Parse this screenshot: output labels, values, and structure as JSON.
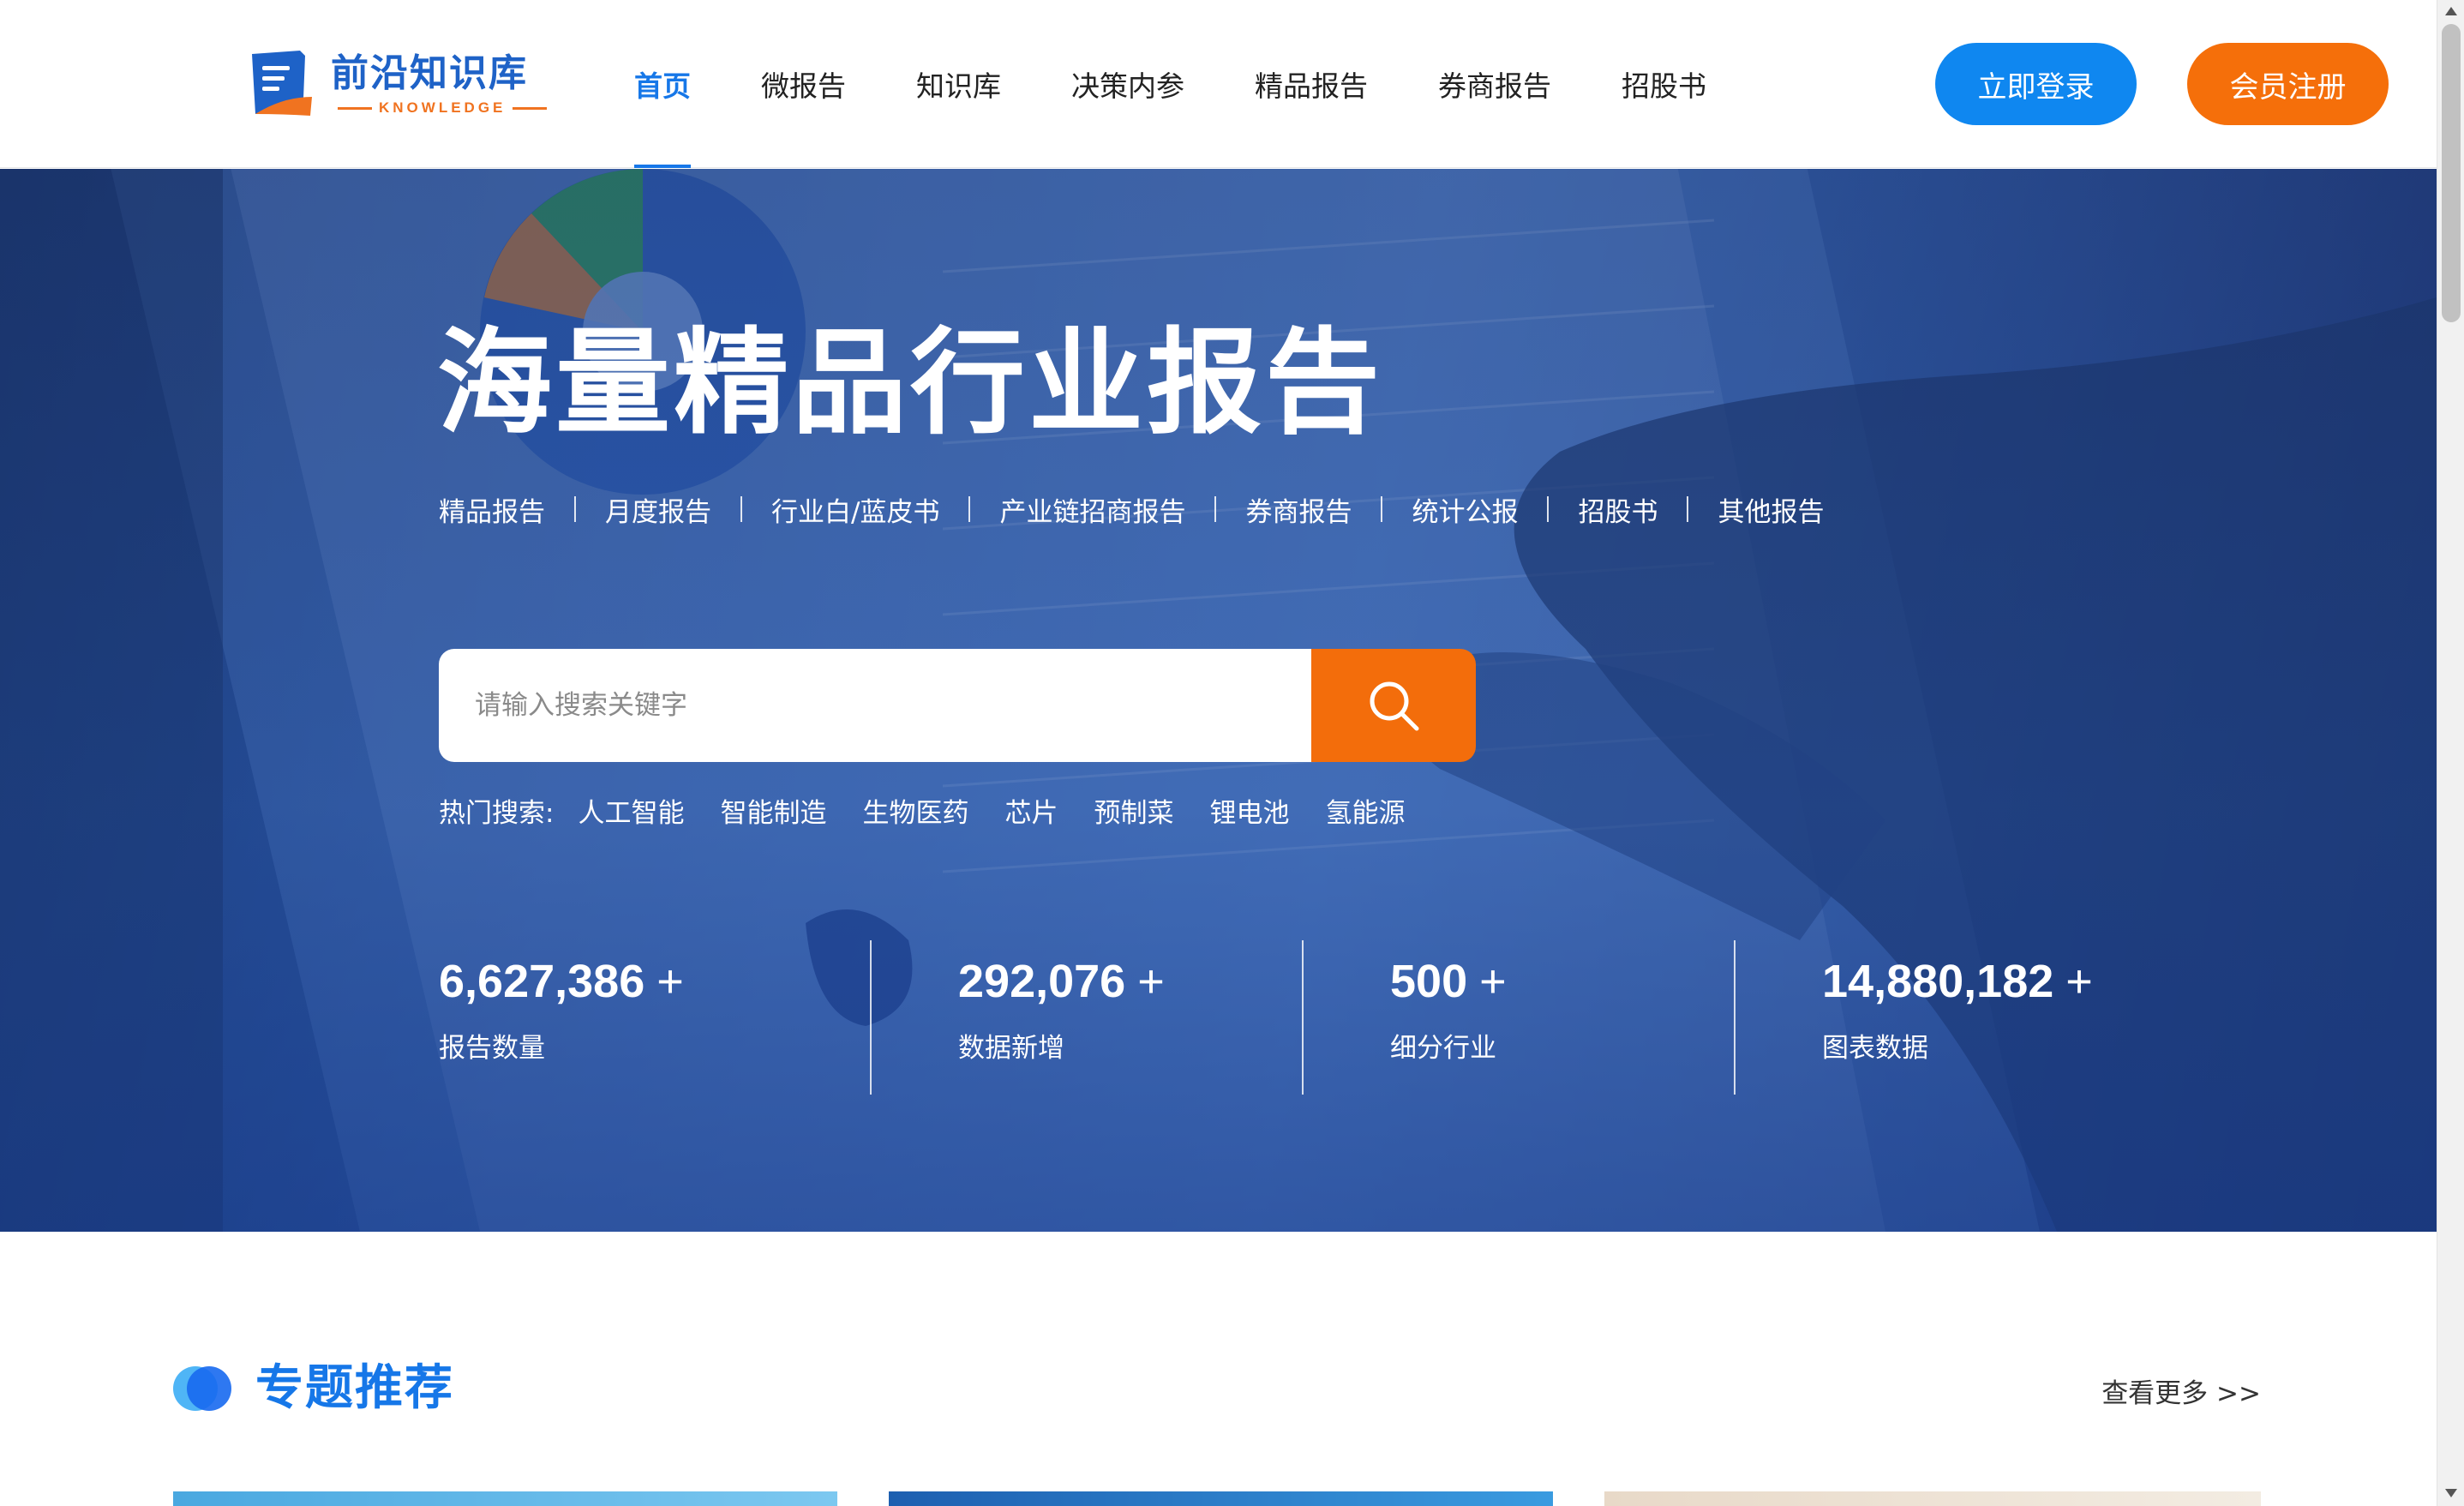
{
  "header": {
    "logo_cn": "前沿知识库",
    "logo_en": "KNOWLEDGE",
    "nav": [
      {
        "label": "首页",
        "active": true
      },
      {
        "label": "微报告",
        "active": false
      },
      {
        "label": "知识库",
        "active": false
      },
      {
        "label": "决策内参",
        "active": false
      },
      {
        "label": "精品报告",
        "active": false
      },
      {
        "label": "券商报告",
        "active": false
      },
      {
        "label": "招股书",
        "active": false
      }
    ],
    "login_label": "立即登录",
    "register_label": "会员注册"
  },
  "hero": {
    "title": "海量精品行业报告",
    "categories": [
      "精品报告",
      "月度报告",
      "行业白/蓝皮书",
      "产业链招商报告",
      "券商报告",
      "统计公报",
      "招股书",
      "其他报告"
    ],
    "search": {
      "placeholder": "请输入搜索关键字",
      "icon": "search-icon"
    },
    "hot_label": "热门搜索:",
    "hot_terms": [
      "人工智能",
      "智能制造",
      "生物医药",
      "芯片",
      "预制菜",
      "锂电池",
      "氢能源"
    ],
    "stats": [
      {
        "value": "6,627,386",
        "suffix": "+",
        "label": "报告数量"
      },
      {
        "value": "292,076",
        "suffix": "+",
        "label": "数据新增"
      },
      {
        "value": "500",
        "suffix": "+",
        "label": "细分行业"
      },
      {
        "value": "14,880,182",
        "suffix": "+",
        "label": "图表数据"
      }
    ]
  },
  "section": {
    "title": "专题推荐",
    "more_label": "查看更多 >>"
  },
  "colors": {
    "primary_blue": "#1677e8",
    "login_blue": "#0f87f0",
    "accent_orange": "#f56f0a",
    "hero_blue": "#2d5aa8"
  }
}
